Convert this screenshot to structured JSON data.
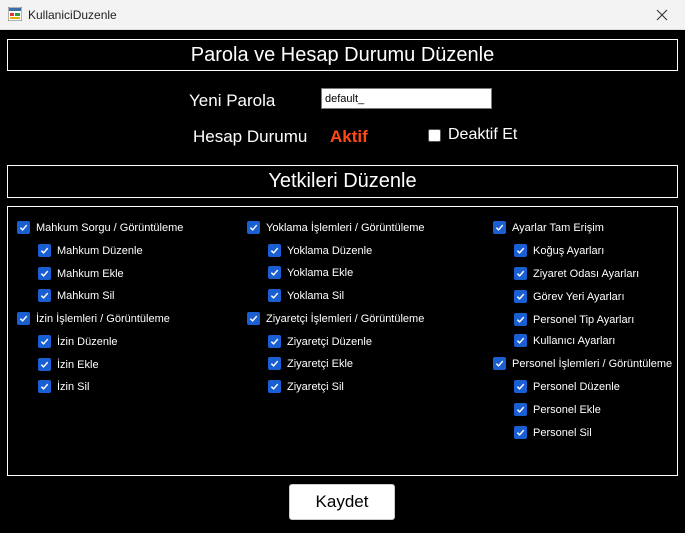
{
  "window": {
    "title": "KullaniciDuzenle"
  },
  "header": {
    "title": "Parola ve Hesap Durumu Düzenle"
  },
  "password": {
    "label": "Yeni Parola",
    "value": "default_"
  },
  "account": {
    "label": "Hesap Durumu",
    "status": "Aktif",
    "status_color": "#ff4a16",
    "deactivate_label": "Deaktif Et",
    "deactivate_checked": false
  },
  "permissions": {
    "title": "Yetkileri Düzenle",
    "col1": {
      "g1": {
        "label": "Mahkum Sorgu / Görüntüleme",
        "items": [
          "Mahkum Düzenle",
          "Mahkum Ekle",
          "Mahkum Sil"
        ]
      },
      "g2": {
        "label": "İzin İşlemleri / Görüntüleme",
        "items": [
          "İzin Düzenle",
          "İzin Ekle",
          "İzin Sil"
        ]
      }
    },
    "col2": {
      "g1": {
        "label": "Yoklama İşlemleri / Görüntüleme",
        "items": [
          "Yoklama Düzenle",
          "Yoklama Ekle",
          "Yoklama Sil"
        ]
      },
      "g2": {
        "label": "Ziyaretçi İşlemleri / Görüntüleme",
        "items": [
          "Ziyaretçi Düzenle",
          "Ziyaretçi Ekle",
          "Ziyaretçi Sil"
        ]
      }
    },
    "col3": {
      "g1": {
        "label": "Ayarlar Tam Erişim",
        "items": [
          "Koğuş Ayarları",
          "Ziyaret Odası Ayarları",
          "Görev Yeri Ayarları",
          "Personel Tip Ayarları",
          "Kullanıcı Ayarları"
        ]
      },
      "g2": {
        "label": "Personel İşlemleri / Görüntüleme",
        "items": [
          "Personel Düzenle",
          "Personel Ekle",
          "Personel Sil"
        ]
      }
    },
    "checkbox_color": "#1a5fd1"
  },
  "actions": {
    "save_label": "Kaydet"
  }
}
